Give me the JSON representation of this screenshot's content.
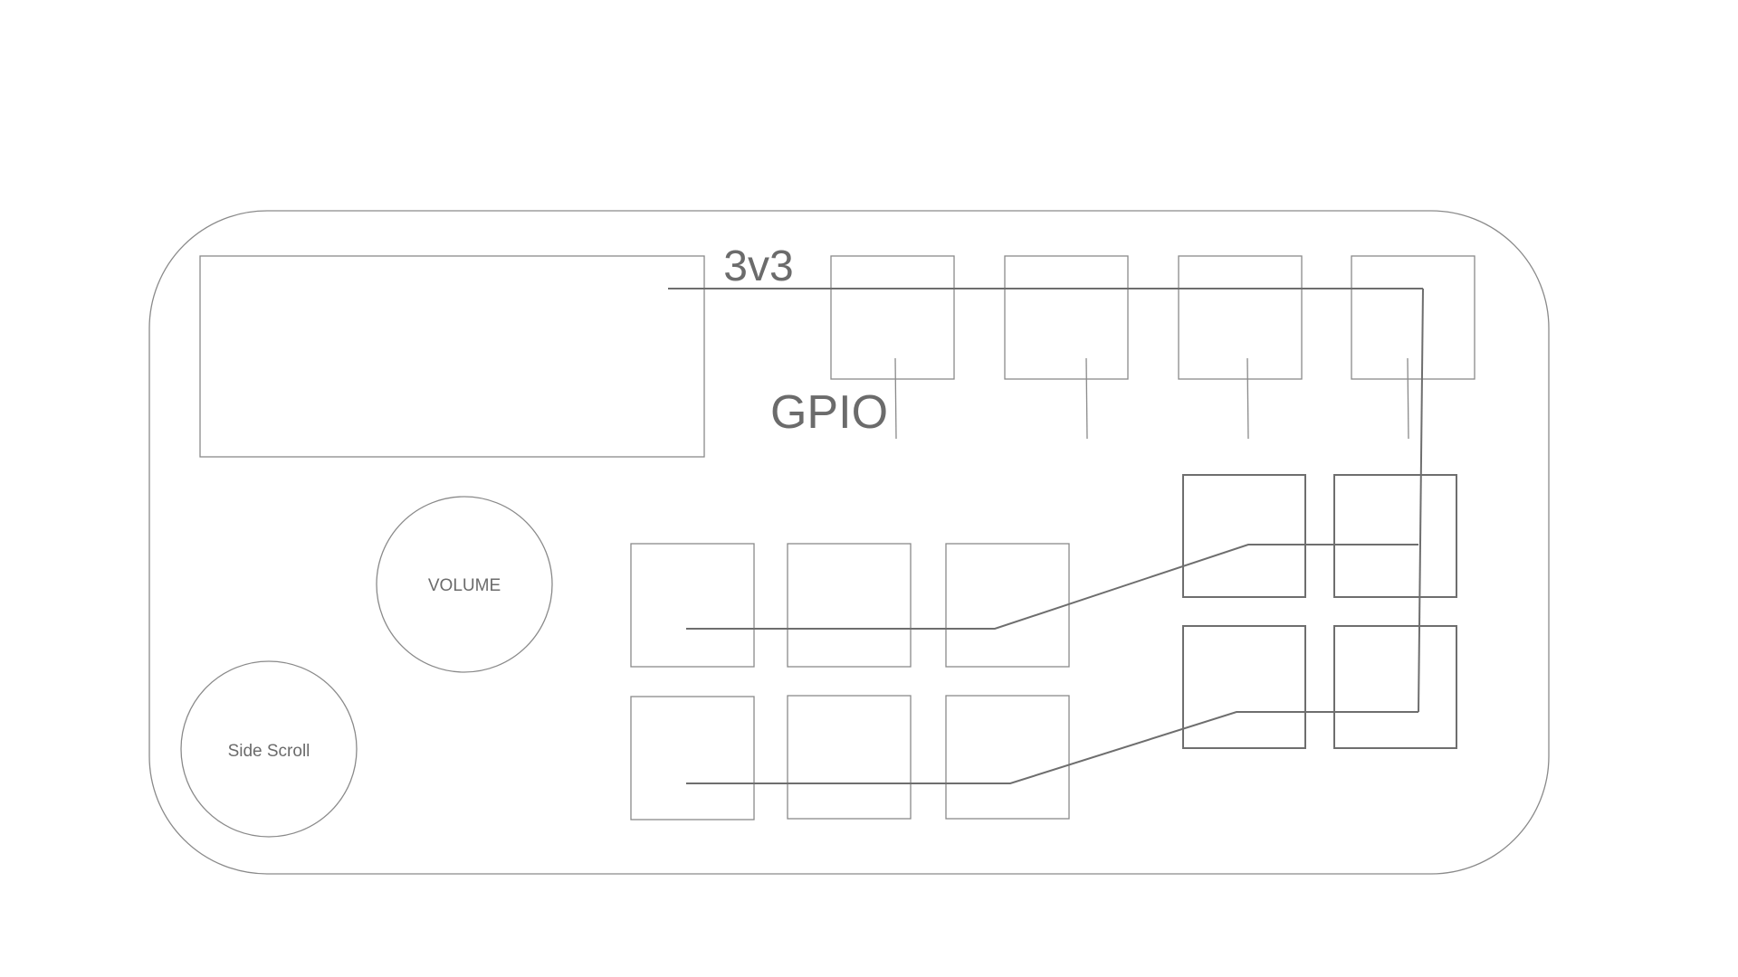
{
  "labels": {
    "power_rail": "3v3",
    "gpio": "GPIO",
    "volume_knob": "VOLUME",
    "side_scroll_knob": "Side Scroll"
  },
  "colors": {
    "outline": "#8a8a8a",
    "wire": "#6e6e6e",
    "text": "#6b6b6b",
    "background": "#ffffff"
  }
}
